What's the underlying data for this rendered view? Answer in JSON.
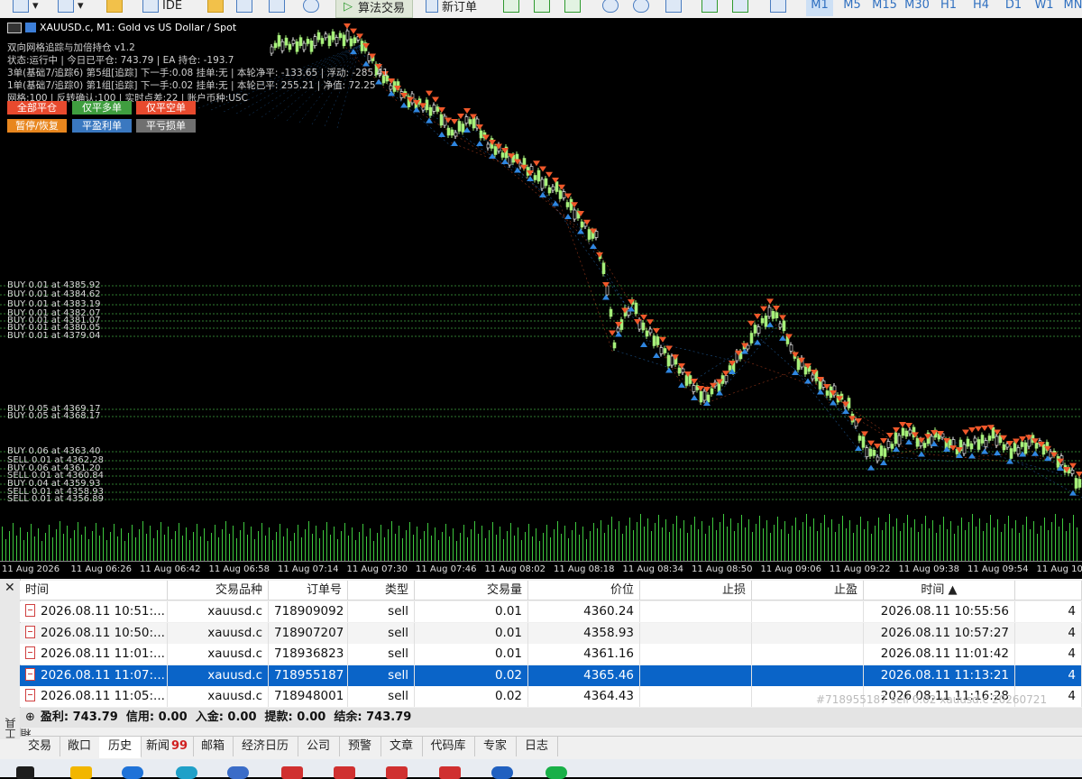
{
  "toolbar": {
    "ide_label": "IDE",
    "algo_label": "算法交易",
    "new_order_label": "新订单",
    "timeframes": [
      "M1",
      "M5",
      "M15",
      "M30",
      "H1",
      "H4",
      "D1",
      "W1",
      "MN"
    ]
  },
  "chart": {
    "title": "XAUUSD.c, M1:  Gold vs US Dollar / Spot",
    "bg_color": "#000000",
    "ea_lines": [
      "双向网格追踪与加倍持仓 v1.2",
      "状态:运行中 | 今日已平仓: 743.79 | EA 持仓: -193.7",
      "3单(基础7/追踪6) 第5组[追踪] 下一手:0.08 挂单:无 | 本轮净平: -133.65 | 浮动: -285.41",
      "1单(基础7/追踪0) 第1组[追踪] 下一手:0.02 挂单:无 | 本轮已平: 255.21 | 净值: 72.25",
      "网格:100 | 反转确认:100 | 实时点差:22 | 账户币种:USC"
    ],
    "buttons": [
      {
        "label": "全部平仓",
        "color": "#e84a2e"
      },
      {
        "label": "仅平多单",
        "color": "#3f9e3f"
      },
      {
        "label": "仅平空单",
        "color": "#e84a2e"
      },
      {
        "label": "暂停/恢复",
        "color": "#e8861e"
      },
      {
        "label": "平盈利单",
        "color": "#3a78c0"
      },
      {
        "label": "平亏损单",
        "color": "#707070"
      }
    ],
    "level_labels": [
      "BUY 0.01 at 4385.92",
      "BUY 0.01 at 4384.62",
      "BUY 0.01 at 4383.19",
      "BUY 0.01 at 4382.07",
      "BUY 0.01 at 4381.07",
      "BUY 0.01 at 4380.05",
      "BUY 0.01 at 4379.04",
      "BUY 0.05 at 4369.17",
      "BUY 0.05 at 4368.17",
      "BUY 0.06 at 4363.40",
      "SELL 0.01 at 4362.28",
      "BUY 0.06 at 4361.20",
      "SELL 0.01 at 4360.84",
      "BUY 0.04 at 4359.93",
      "SELL 0.01 at 4358.93",
      "SELL 0.01 at 4356.89"
    ],
    "x_ticks": [
      "11 Aug 2026",
      "11 Aug 06:26",
      "11 Aug 06:42",
      "11 Aug 06:58",
      "11 Aug 07:14",
      "11 Aug 07:30",
      "11 Aug 07:46",
      "11 Aug 08:02",
      "11 Aug 08:18",
      "11 Aug 08:34",
      "11 Aug 08:50",
      "11 Aug 09:06",
      "11 Aug 09:22",
      "11 Aug 09:38",
      "11 Aug 09:54",
      "11 Aug 10"
    ],
    "colors": {
      "bull_candle": "#a6f07a",
      "bear_candle": "#ffffff",
      "sell_marker": "#f0582a",
      "buy_marker": "#2f86e0",
      "level_line": "#3c9a3c",
      "volume": "#3ec83e"
    }
  },
  "history": {
    "columns": [
      "时间",
      "交易品种",
      "订单号",
      "类型",
      "交易量",
      "价位",
      "止损",
      "止盈",
      "时间 ▲"
    ],
    "rows": [
      {
        "open_time": "2026.08.11 10:51:...",
        "symbol": "xauusd.c",
        "order": "718909092",
        "type": "sell",
        "volume": "0.01",
        "price": "4360.24",
        "sl": "",
        "tp": "",
        "close_time": "2026.08.11 10:55:56",
        "extra": "4"
      },
      {
        "open_time": "2026.08.11 10:50:...",
        "symbol": "xauusd.c",
        "order": "718907207",
        "type": "sell",
        "volume": "0.01",
        "price": "4358.93",
        "sl": "",
        "tp": "",
        "close_time": "2026.08.11 10:57:27",
        "extra": "4"
      },
      {
        "open_time": "2026.08.11 11:01:...",
        "symbol": "xauusd.c",
        "order": "718936823",
        "type": "sell",
        "volume": "0.01",
        "price": "4361.16",
        "sl": "",
        "tp": "",
        "close_time": "2026.08.11 11:01:42",
        "extra": "4"
      },
      {
        "open_time": "2026.08.11 11:07:...",
        "symbol": "xauusd.c",
        "order": "718955187",
        "type": "sell",
        "volume": "0.02",
        "price": "4365.46",
        "sl": "",
        "tp": "",
        "close_time": "2026.08.11 11:13:21",
        "extra": "4"
      },
      {
        "open_time": "2026.08.11 11:05:...",
        "symbol": "xauusd.c",
        "order": "718948001",
        "type": "sell",
        "volume": "0.02",
        "price": "4364.43",
        "sl": "",
        "tp": "",
        "close_time": "2026.08.11 11:16:28",
        "extra": "4"
      }
    ],
    "selected_row": 3,
    "tooltip_text": "#718955187 sell 0.02 xauusd.c 20260721",
    "summary": "盈利: 743.79  信用: 0.00  入金: 0.00  提款: 0.00  结余: 743.79"
  },
  "toolbox": {
    "side_label": "工具箱",
    "tabs": [
      {
        "label": "交易",
        "badge": ""
      },
      {
        "label": "敞口",
        "badge": ""
      },
      {
        "label": "历史",
        "badge": ""
      },
      {
        "label": "新闻",
        "badge": "99"
      },
      {
        "label": "邮箱",
        "badge": ""
      },
      {
        "label": "经济日历",
        "badge": ""
      },
      {
        "label": "公司",
        "badge": ""
      },
      {
        "label": "预警",
        "badge": ""
      },
      {
        "label": "文章",
        "badge": ""
      },
      {
        "label": "代码库",
        "badge": ""
      },
      {
        "label": "专家",
        "badge": ""
      },
      {
        "label": "日志",
        "badge": ""
      }
    ],
    "active_tab": 2
  }
}
